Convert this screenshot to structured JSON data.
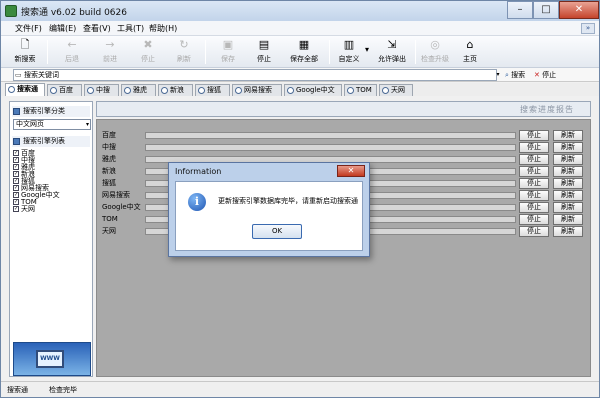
{
  "window": {
    "title": "搜索通 v6.02 build 0626",
    "minimize_glyph": "–",
    "maximize_glyph": "□",
    "close_glyph": "✕"
  },
  "menu": {
    "items": [
      "文件(F)",
      "编辑(E)",
      "查看(V)",
      "工具(T)",
      "帮助(H)"
    ],
    "overflow_glyph": "»"
  },
  "toolbar": {
    "buttons": [
      {
        "label": "新搜索",
        "icon": "new-doc-icon",
        "glyph": "🗋",
        "enabled": true
      },
      {
        "label": "后退",
        "icon": "back-arrow-icon",
        "glyph": "←",
        "enabled": false
      },
      {
        "label": "前进",
        "icon": "forward-arrow-icon",
        "glyph": "→",
        "enabled": false
      },
      {
        "label": "停止",
        "icon": "stop-icon",
        "glyph": "✖",
        "enabled": false
      },
      {
        "label": "刷新",
        "icon": "refresh-icon",
        "glyph": "↻",
        "enabled": false
      },
      {
        "label": "保存",
        "icon": "save-icon",
        "glyph": "▣",
        "enabled": false
      },
      {
        "label": "停止",
        "icon": "stop-doc-icon",
        "glyph": "▤",
        "enabled": true
      },
      {
        "label": "保存全部",
        "icon": "save-all-icon",
        "glyph": "▦",
        "enabled": true
      },
      {
        "label": "自定义",
        "icon": "customize-icon",
        "glyph": "▥",
        "enabled": true
      },
      {
        "label": "允许弹出",
        "icon": "popup-icon",
        "glyph": "⇲",
        "enabled": true
      },
      {
        "label": "检查升级",
        "icon": "check-update-icon",
        "glyph": "◎",
        "enabled": false
      },
      {
        "label": "主页",
        "icon": "home-icon",
        "glyph": "⌂",
        "enabled": true
      }
    ],
    "dropdown_glyph": "▾"
  },
  "keyword": {
    "placeholder": "搜索关键词",
    "value": "搜索关键词",
    "search_label": "搜索",
    "stop_label": "停止",
    "dropdown_glyph": "▾",
    "search_glyph": "⌕",
    "stop_glyph": "✕"
  },
  "tabs": [
    "搜索通",
    "百度",
    "中搜",
    "雅虎",
    "新浪",
    "搜狐",
    "网易搜索",
    "Google中文",
    "TOM",
    "天网"
  ],
  "left_panel": {
    "category_header": "搜索引擎分类",
    "category_selected": "中文网页",
    "list_header": "搜索引擎列表",
    "engines": [
      "百度",
      "中搜",
      "雅虎",
      "新浪",
      "搜狐",
      "网易搜索",
      "Google中文",
      "TOM",
      "天网"
    ],
    "checked": true,
    "check_glyph": "✓",
    "dropdown_glyph": "▾",
    "banner_text": "WWW"
  },
  "right_panel": {
    "header": "搜索进度报告",
    "rows": [
      {
        "name": "百度",
        "progress": 0
      },
      {
        "name": "中搜",
        "progress": 0
      },
      {
        "name": "雅虎",
        "progress": 0
      },
      {
        "name": "新浪",
        "progress": 0
      },
      {
        "name": "搜狐",
        "progress": 0
      },
      {
        "name": "网易搜索",
        "progress": 0
      },
      {
        "name": "Google中文",
        "progress": 0
      },
      {
        "name": "TOM",
        "progress": 0
      },
      {
        "name": "天网",
        "progress": 0
      }
    ],
    "stop_label": "停止",
    "refresh_label": "刷新"
  },
  "dialog": {
    "title": "Information",
    "message": "更新搜索引擎数据库完毕，请重新启动搜索通",
    "ok_label": "OK",
    "close_glyph": "✕",
    "info_glyph": "i"
  },
  "status": {
    "left": "搜索通",
    "right": "检查完毕"
  },
  "colors": {
    "window_frame": "#6e86a6",
    "progress_area": "#a9a9a9",
    "dialog_frame": "#bcd0ea",
    "close_red": "#c2391f"
  }
}
